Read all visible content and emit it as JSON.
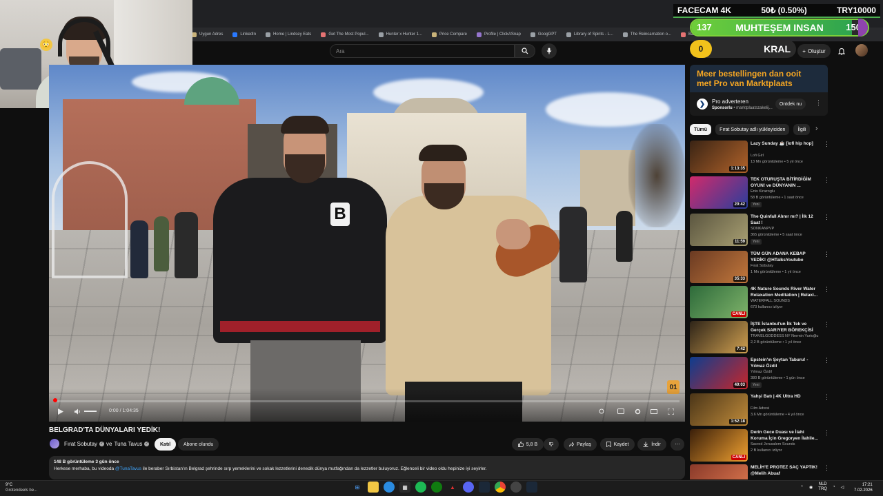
{
  "browser": {
    "bookmarks": [
      "Uygun Adres",
      "LinkedIn",
      "Home | Lindsey Eats",
      "Get The Most Popul...",
      "Hunter x Hunter 1...",
      "Price Compare",
      "Profile | ClickASnap",
      "GoogGPT",
      "Library of Spirits - L...",
      "The Reincarnation o...",
      "Basics of Online M..."
    ]
  },
  "overlay": {
    "facecam_label": "FACECAM 4K",
    "price": "50₺ (0.50%)",
    "goal_currency": "TRY10000",
    "goal_left": "137",
    "goal_title": "MUHTEŞEM INSAN",
    "goal_right": "150",
    "goal_progress": 0.91,
    "rank_value": "0",
    "rank_title": "KRAL",
    "accent": "#7cd13a"
  },
  "header": {
    "search_placeholder": "Ara",
    "create_label": "Oluştur",
    "icons": [
      "search-icon",
      "microphone-icon",
      "plus-icon",
      "bell-icon"
    ]
  },
  "player": {
    "time": "0:00 / 1:04:35",
    "watermark": "01",
    "progress": 0.0
  },
  "video": {
    "title": "BELGRAD'TA DÜNYALARI YEDİK!",
    "channel_1": "Fırat Sobutay",
    "and": "ve",
    "channel_2": "Tuna Tavus",
    "join_label": "Katıl",
    "subscribed_label": "Abone olundu",
    "likes": "5,8 B",
    "share_label": "Paylaş",
    "save_label": "Kaydet",
    "download_label": "İndir",
    "views_date": "148 B görüntüleme  3 gün önce",
    "desc_before": "Herkese merhaba, bu videoda ",
    "desc_mention": "@TunaTavus",
    "desc_after": " ile beraber Sırbistan'ın Belgrad şehrinde sırp yemeklerini ve sokak lezzetlerini denedik dünya mutfağından da lezzetler buluyoruz. Eğlenceli bir video oldu hepinize iyi seyirler."
  },
  "ad": {
    "headline_1": "Meer bestellingen dan ooit",
    "headline_2": "met Pro van Marktplaats",
    "title": "Pro adverteren",
    "sponsor": "Sponsorlu",
    "domain": "marktplaatszakelij...",
    "cta": "Ontdek nu",
    "brand_color": "#f5a623"
  },
  "chips": [
    "Tümü",
    "Fırat Sobutay adlı yükleyiciden",
    "İlgili"
  ],
  "recommendations": [
    {
      "title": "Lazy Sunday ☕ [lofi hip hop]",
      "channel": "Lofi Girl",
      "meta": "13 Mn görüntüleme • 5 yıl önce",
      "duration": "1:13:35",
      "badge": "",
      "live": ""
    },
    {
      "title": "TEK OTURUŞTA BİTİRDİĞİM OYUN! ve DÜNYANIN ...",
      "channel": "Enis Kirazoglu",
      "meta": "58 B görüntüleme • 1 saat önce",
      "duration": "20:42",
      "badge": "Yeni",
      "live": ""
    },
    {
      "title": "The Quinfall Alınır mı? | İlk 12 Saat !",
      "channel": "SONKANPVP",
      "meta": "365 görüntüleme • 5 saat önce",
      "duration": "11:59",
      "badge": "Yeni",
      "live": ""
    },
    {
      "title": "TÜM GÜN ADANA KEBAP YEDİK! @HTalksYoutube",
      "channel": "Fırat Sobutay",
      "meta": "1 Mn görüntüleme • 1 yıl önce",
      "duration": "35:33",
      "badge": "",
      "live": ""
    },
    {
      "title": "4K Nature Sounds River Water Relaxation Meditation | Relaxi...",
      "channel": "WATERFALL SOUNDS",
      "meta": "673 kullanıcı izliyor",
      "duration": "",
      "badge": "",
      "live": "CANLI"
    },
    {
      "title": "İŞTE İstanbul'un İlk Tek ve Gerçek SARIYER BÖREKÇİSİ",
      "channel": "TRAVELGODDESS NY Nermin Yurtoğlu",
      "meta": "2,2 B görüntüleme • 1 yıl önce",
      "duration": "7:42",
      "badge": "",
      "live": ""
    },
    {
      "title": "Epstein'ın Şeytan Taburu! - Yılmaz Özdil",
      "channel": "Yılmaz Özdil",
      "meta": "380 B görüntüleme • 1 gün önce",
      "duration": "40:03",
      "badge": "Yeni",
      "live": ""
    },
    {
      "title": "Yahşi Batı | 4K Ultra HD",
      "channel": "Film Adresi",
      "meta": "3,6 Mn görüntüleme • 4 yıl önce",
      "duration": "1:52:18",
      "badge": "",
      "live": ""
    },
    {
      "title": "Derin Gece Duası ve İlahi Koruma İçin Gregoryen İlahile...",
      "channel": "Sacred Jerusalem Sounds",
      "meta": "2 B kullanıcı izliyor",
      "duration": "",
      "badge": "",
      "live": "CANLI"
    },
    {
      "title": "MELİH'E PROTEZ SAÇ YAPTIK! @Melih Abuaf",
      "channel": "",
      "meta": "",
      "duration": "",
      "badge": "",
      "live": ""
    }
  ],
  "taskbar": {
    "temp": "9°C",
    "weather": "Grotendeels be...",
    "lang_1": "NLD",
    "lang_2": "TRQ",
    "time": "17:21",
    "date": "7.02.2026"
  }
}
